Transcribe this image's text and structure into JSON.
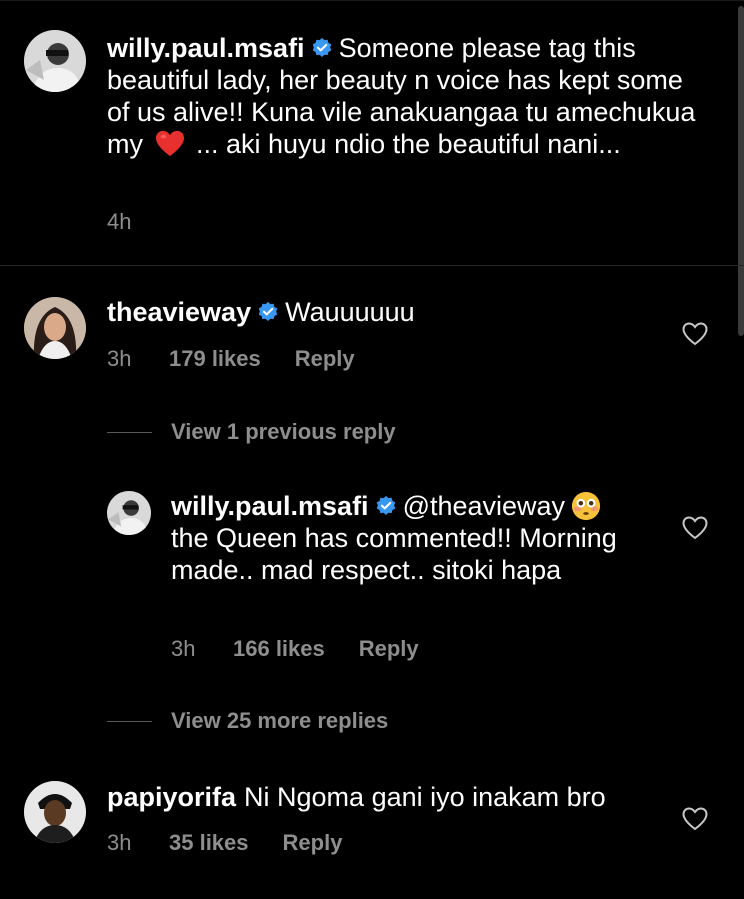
{
  "caption": {
    "username": "willy.paul.msafi",
    "text_part1": "Someone please tag this beautiful lady, her beauty n voice has kept some of us alive!! Kuna vile anakuangaa tu amechukua my",
    "text_part2": "... aki huyu ndio the beautiful nani...",
    "time": "4h"
  },
  "comments": [
    {
      "username": "theavieway",
      "text": "Wauuuuuu",
      "time": "3h",
      "likes": "179 likes",
      "reply": "Reply",
      "view_previous": "View 1 previous reply",
      "replies": [
        {
          "username": "willy.paul.msafi",
          "mention": "@theavieway",
          "text": "the Queen has commented!! Morning made.. mad respect.. sitoki hapa",
          "time": "3h",
          "likes": "166 likes",
          "reply": "Reply"
        }
      ],
      "view_more": "View 25 more replies"
    },
    {
      "username": "papiyorifa",
      "text": "Ni Ngoma gani iyo inakam bro",
      "time": "3h",
      "likes": "35 likes",
      "reply": "Reply"
    }
  ],
  "icons": {
    "verified": "verified-badge-icon",
    "like": "heart-outline-icon",
    "heart_emoji": "red-heart-emoji",
    "flushed_emoji": "flushed-face-emoji"
  },
  "colors": {
    "background": "#000000",
    "text": "#ffffff",
    "secondary": "#8e8e8e",
    "verified": "#3897f0"
  }
}
